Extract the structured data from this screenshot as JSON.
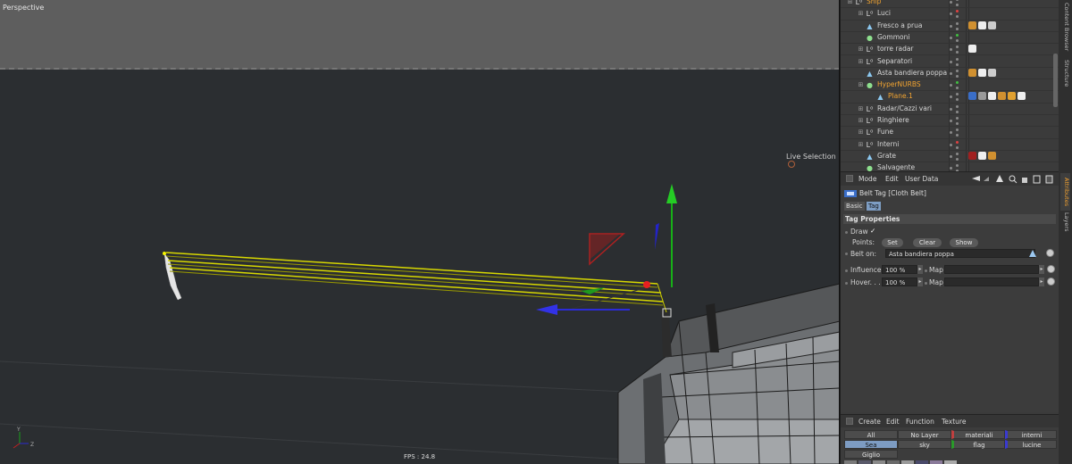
{
  "viewport": {
    "label": "Perspective",
    "live_selection": "Live Selection",
    "fps": "FPS : 24.8",
    "axis_y": "Y",
    "axis_z": "Z"
  },
  "object_manager": {
    "rows": [
      {
        "name": "Ship",
        "indent": 1,
        "type": "null",
        "orange": true
      },
      {
        "name": "Luci",
        "indent": 2,
        "type": "null"
      },
      {
        "name": "Fresco a prua",
        "indent": 2,
        "type": "poly"
      },
      {
        "name": "Gommoni",
        "indent": 2,
        "type": "sphere"
      },
      {
        "name": "torre radar",
        "indent": 2,
        "type": "null"
      },
      {
        "name": "Separatori",
        "indent": 2,
        "type": "null"
      },
      {
        "name": "Asta bandiera poppa",
        "indent": 2,
        "type": "poly"
      },
      {
        "name": "HyperNURBS",
        "indent": 2,
        "type": "sphere",
        "orange": true
      },
      {
        "name": "Plane.1",
        "indent": 3,
        "type": "poly",
        "orange": true
      },
      {
        "name": "Radar/Cazzi vari",
        "indent": 2,
        "type": "null"
      },
      {
        "name": "Ringhiere",
        "indent": 2,
        "type": "null"
      },
      {
        "name": "Fune",
        "indent": 2,
        "type": "null"
      },
      {
        "name": "Interni",
        "indent": 2,
        "type": "null"
      },
      {
        "name": "Grate",
        "indent": 2,
        "type": "poly"
      },
      {
        "name": "Salvagente",
        "indent": 2,
        "type": "sphere"
      }
    ]
  },
  "side_tabs": {
    "content_browser": "Content Browser",
    "structure": "Structure",
    "attributes": "Attributes",
    "layers": "Layers"
  },
  "attributes": {
    "menu": {
      "mode": "Mode",
      "edit": "Edit",
      "user_data": "User Data"
    },
    "title": "Belt Tag [Cloth Belt]",
    "tabs": {
      "basic": "Basic",
      "tag": "Tag"
    },
    "section": "Tag Properties",
    "draw_label": "Draw",
    "draw_check": "✓",
    "points_label": "Points:",
    "set_btn": "Set",
    "clear_btn": "Clear",
    "show_btn": "Show",
    "belt_on_label": "Belt on:",
    "belt_on_value": "Asta bandiera poppa",
    "influence_label": "Influence",
    "influence_value": "100 %",
    "hover_label": "Hover. . . .",
    "hover_value": "100 %",
    "map_label": "Map",
    "map2_label": "Map"
  },
  "layers": {
    "menu": {
      "create": "Create",
      "edit": "Edit",
      "function": "Function",
      "texture": "Texture"
    },
    "cells": {
      "all": "All",
      "no_layer": "No Layer",
      "materiali": "materiali carena",
      "interni": "interni",
      "sea": "Sea",
      "sky": "sky",
      "flag": "flag",
      "lucine": "lucine",
      "giglio": "Giglio"
    }
  }
}
